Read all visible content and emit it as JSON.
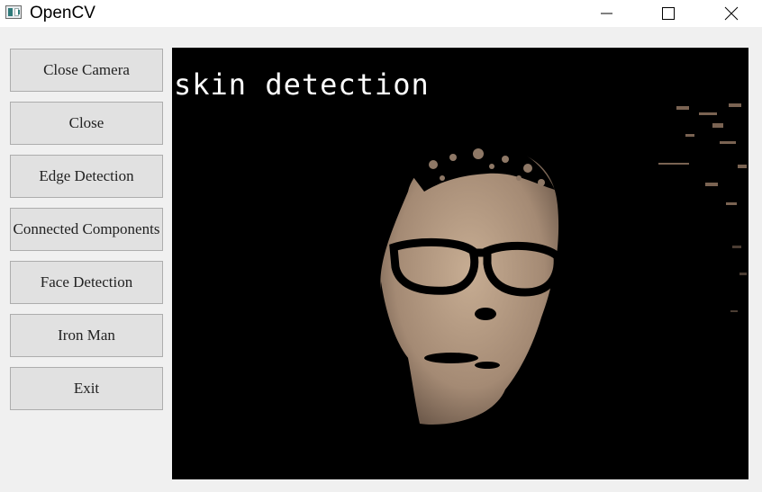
{
  "window": {
    "title": "OpenCV",
    "icon": "opencv-window-icon",
    "controls": [
      "minimize-icon",
      "maximize-icon",
      "close-icon"
    ]
  },
  "sidebar": {
    "buttons": [
      {
        "label": "Close Camera"
      },
      {
        "label": "Close"
      },
      {
        "label": "Edge Detection"
      },
      {
        "label": "Connected Components"
      },
      {
        "label": "Face Detection"
      },
      {
        "label": "Iron Man"
      },
      {
        "label": "Exit"
      }
    ]
  },
  "video": {
    "overlay_text": "skin detection",
    "background": "#000000",
    "overlay_color": "#ffffff"
  },
  "colors": {
    "skin": "#b39a82",
    "skin_shadow": "#7a6555",
    "button_face": "#e1e1e1",
    "button_border": "#adadad"
  }
}
